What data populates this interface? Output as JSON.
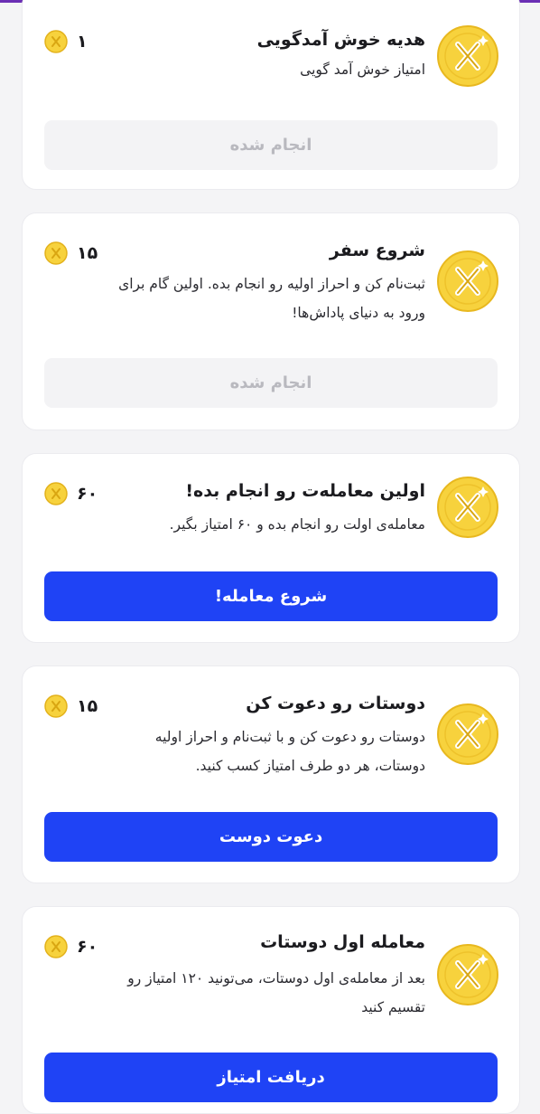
{
  "colors": {
    "accent": "#1f43f5",
    "coin": "#f7d23d",
    "done_bg": "#f3f3f5",
    "done_text": "#b9b9bf",
    "top_bar": "#6b2fb4"
  },
  "tasks": [
    {
      "title": "هدیه خوش آمدگویی",
      "description": "امتیاز خوش آمد گویی",
      "points": "۱",
      "button_label": "انجام شده",
      "button_state": "done",
      "icon": "coin-x-icon"
    },
    {
      "title": "شروع سفر",
      "description": "ثبت‌نام کن و احراز اولیه رو انجام بده. اولین گام برای ورود به دنیای پاداش‌ها!",
      "points": "۱۵",
      "button_label": "انجام شده",
      "button_state": "done",
      "icon": "coin-x-icon"
    },
    {
      "title": "اولین معامله‌ت رو انجام بده!",
      "description": "معامله‌ی اولت رو انجام بده و ۶۰ امتیاز بگیر.",
      "points": "۶۰",
      "button_label": "شروع معامله!",
      "button_state": "active",
      "icon": "coin-x-icon"
    },
    {
      "title": "دوستات رو دعوت کن",
      "description": "دوستات رو دعوت کن و با ثبت‌نام و احراز اولیه دوستات، هر دو طرف امتیاز کسب کنید.",
      "points": "۱۵",
      "button_label": "دعوت دوست",
      "button_state": "active",
      "icon": "coin-x-icon"
    },
    {
      "title": "معامله اول دوستات",
      "description": "بعد از معامله‌ی اول دوستات، می‌تونید ۱۲۰ امتیاز رو تقسیم کنید",
      "points": "۶۰",
      "button_label": "دریافت امتیاز",
      "button_state": "active",
      "icon": "coin-x-icon"
    }
  ]
}
